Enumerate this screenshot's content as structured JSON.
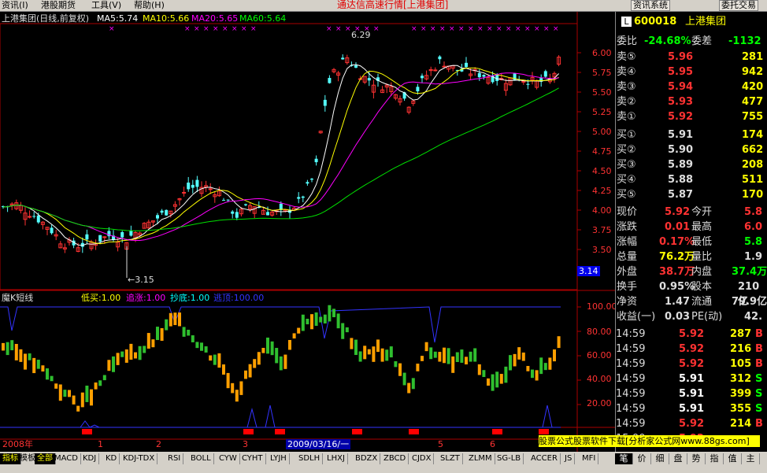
{
  "menu": {
    "items": [
      "资讯(I)",
      "港股期货",
      "工具(V)",
      "帮助(H)"
    ],
    "title": "通达信高速行情[上港集团]",
    "buttons": [
      "资讯系统",
      "委托交易"
    ]
  },
  "main": {
    "header_name": "上港集团(日线,前复权)",
    "ma5": "MA5:5.74",
    "ma10": "MA10:5.66",
    "ma20": "MA20:5.65",
    "ma60": "MA60:5.64",
    "high_label": "6.29",
    "low_label": "←3.15",
    "price_ticks": [
      "6.00",
      "5.75",
      "5.50",
      "5.25",
      "5.00",
      "4.75",
      "4.50",
      "4.25",
      "4.00",
      "3.75",
      "3.50"
    ],
    "cursor_value": "3.14"
  },
  "indicator": {
    "name": "魔K短线",
    "p1": "低买:1.00",
    "p2": "追涨:1.00",
    "p3": "抄底:1.00",
    "p4": "逃顶:100.00",
    "ticks": [
      "100.00",
      "80.00",
      "60.00",
      "40.00",
      "20.00"
    ]
  },
  "time_axis": {
    "year": "2008年",
    "months": [
      "1",
      "2",
      "3",
      "5",
      "6"
    ],
    "selected_date": "2009/03/16/一"
  },
  "quote": {
    "code": "600018",
    "name": "上港集团",
    "webi_label": "委比",
    "webi": "-24.68%",
    "weicha_label": "委差",
    "weicha": "-1132",
    "asks": [
      {
        "label": "卖⑤",
        "price": "5.96",
        "vol": "281"
      },
      {
        "label": "卖④",
        "price": "5.95",
        "vol": "942"
      },
      {
        "label": "卖③",
        "price": "5.94",
        "vol": "420"
      },
      {
        "label": "卖②",
        "price": "5.93",
        "vol": "477"
      },
      {
        "label": "卖①",
        "price": "5.92",
        "vol": "755"
      }
    ],
    "bids": [
      {
        "label": "买①",
        "price": "5.91",
        "vol": "174"
      },
      {
        "label": "买②",
        "price": "5.90",
        "vol": "662"
      },
      {
        "label": "买③",
        "price": "5.89",
        "vol": "208"
      },
      {
        "label": "买④",
        "price": "5.88",
        "vol": "511"
      },
      {
        "label": "买⑤",
        "price": "5.87",
        "vol": "170"
      }
    ],
    "stats": [
      {
        "l1": "现价",
        "v1": "5.92",
        "l2": "今开",
        "v2": "5.8"
      },
      {
        "l1": "涨跌",
        "v1": "0.01",
        "l2": "最高",
        "v2": "6.0"
      },
      {
        "l1": "涨幅",
        "v1": "0.17%",
        "l2": "最低",
        "v2": "5.8"
      },
      {
        "l1": "总量",
        "v1": "76.2万",
        "l2": "量比",
        "v2": "1.9"
      },
      {
        "l1": "外盘",
        "v1": "38.7万",
        "l2": "内盘",
        "v2": "37.4万"
      },
      {
        "l1": "换手",
        "v1": "0.95%",
        "l2": "股本",
        "v2": "210亿"
      },
      {
        "l1": "净资",
        "v1": "1.47",
        "l2": "流通",
        "v2": "79.9亿"
      },
      {
        "l1": "收益(一)",
        "v1": "0.03",
        "l2": "PE(动)",
        "v2": "42."
      }
    ],
    "ticks": [
      {
        "time": "14:59",
        "price": "5.92",
        "vol": "287",
        "dir": "B"
      },
      {
        "time": "14:59",
        "price": "5.92",
        "vol": "216",
        "dir": "B"
      },
      {
        "time": "14:59",
        "price": "5.92",
        "vol": "105",
        "dir": "B"
      },
      {
        "time": "14:59",
        "price": "5.91",
        "vol": "312",
        "dir": "S"
      },
      {
        "time": "14:59",
        "price": "5.91",
        "vol": "399",
        "dir": "S"
      },
      {
        "time": "14:59",
        "price": "5.91",
        "vol": "355",
        "dir": "S"
      },
      {
        "time": "14:59",
        "price": "5.92",
        "vol": "214",
        "dir": "B"
      },
      {
        "time": "15:00",
        "price": "5.92",
        "vol": "",
        "dir": ""
      }
    ]
  },
  "ad": "股票公式股票软件下载[分析家公式网www.88gs.com]",
  "bottom_tabs": [
    "指标",
    "模板",
    "全部",
    "MACD",
    "KDJ",
    "KD",
    "KDJ-TDX",
    "RSI",
    "BOLL",
    "CYW",
    "CYHT",
    "LYJH",
    "SDLH",
    "LHXJ",
    "BDZX",
    "ZBCD",
    "CJDX",
    "SLZT",
    "ZLMM",
    "SG-LB",
    "ACCER",
    "JS",
    "MFI"
  ],
  "right_tabs": [
    "笔",
    "价",
    "细",
    "盘",
    "势",
    "指",
    "值",
    "主"
  ],
  "colors": {
    "up": "#ff3232",
    "down": "#54ffff",
    "ma5": "#ffffff",
    "ma10": "#ffff00",
    "ma20": "#ff00ff",
    "ma60": "#00e000"
  }
}
